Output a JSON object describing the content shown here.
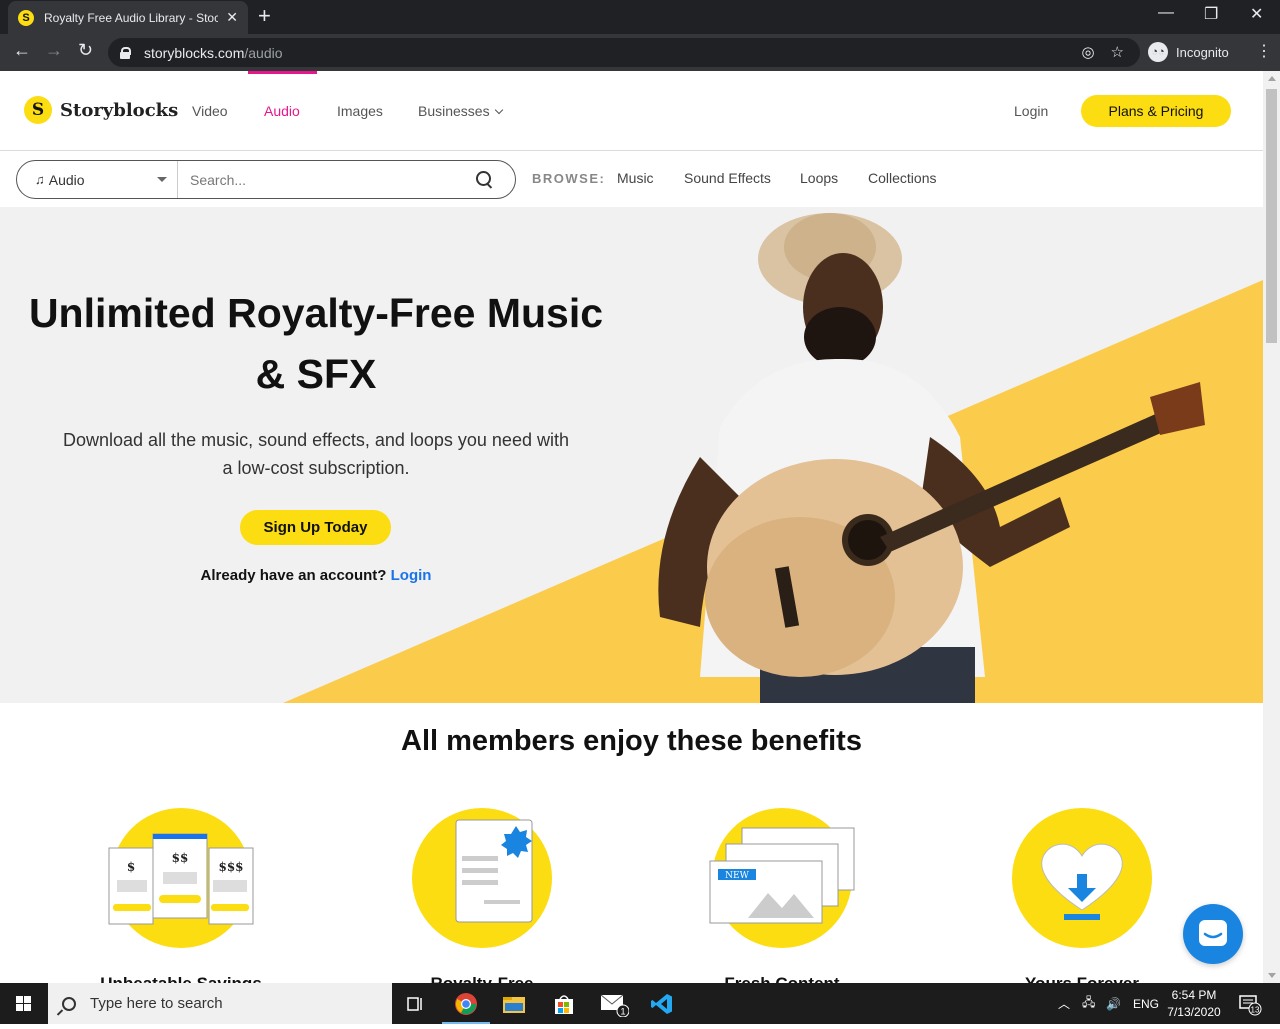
{
  "browser": {
    "tab_title": "Royalty Free Audio Library - Stock",
    "tab_favicon": "S",
    "url_domain": "storyblocks.com",
    "url_path": "/audio",
    "incognito_label": "Incognito"
  },
  "site": {
    "brand": "Storyblocks",
    "logo_mark": "S",
    "nav": [
      {
        "label": "Video"
      },
      {
        "label": "Audio"
      },
      {
        "label": "Images"
      },
      {
        "label": "Businesses"
      }
    ],
    "login": "Login",
    "plans": "Plans & Pricing"
  },
  "search": {
    "type_selected": "Audio",
    "placeholder": "Search...",
    "browse_label": "BROWSE:",
    "browse_links": [
      "Music",
      "Sound Effects",
      "Loops",
      "Collections"
    ]
  },
  "hero": {
    "title_line1": "Unlimited Royalty-Free Music",
    "title_line2": "& SFX",
    "subtitle_line1": "Download all the music, sound effects, and loops you need with",
    "subtitle_line2": "a low-cost subscription.",
    "cta": "Sign Up Today",
    "have_account": "Already have an account?",
    "login_link": "Login"
  },
  "benefits": {
    "title": "All members enjoy these benefits",
    "price_tiers": [
      "$",
      "$$",
      "$$$"
    ],
    "new_badge": "NEW",
    "labels": [
      "Unbeatable Savings",
      "Royalty-Free",
      "Fresh Content",
      "Yours Forever"
    ]
  },
  "taskbar": {
    "search_placeholder": "Type here to search",
    "language": "ENG",
    "time": "6:54 PM",
    "date": "7/13/2020",
    "mail_badge": "1",
    "notification_count": "13"
  },
  "colors": {
    "brand_yellow": "#fbdd11",
    "accent_pink": "#e6178b",
    "link_blue": "#1a73e8"
  }
}
